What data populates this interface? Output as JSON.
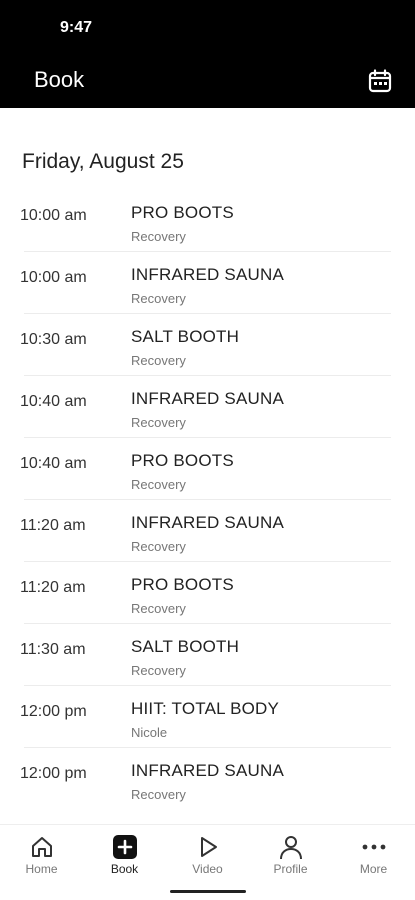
{
  "status_bar": {
    "time": "9:47"
  },
  "header": {
    "title": "Book",
    "calendar_icon": "calendar-icon"
  },
  "date_heading": "Friday, August 25",
  "classes": [
    {
      "time": "10:00 am",
      "name": "PRO BOOTS",
      "sub": "Recovery"
    },
    {
      "time": "10:00 am",
      "name": "INFRARED SAUNA",
      "sub": "Recovery"
    },
    {
      "time": "10:30 am",
      "name": "SALT BOOTH",
      "sub": "Recovery"
    },
    {
      "time": "10:40 am",
      "name": "INFRARED SAUNA",
      "sub": "Recovery"
    },
    {
      "time": "10:40 am",
      "name": "PRO BOOTS",
      "sub": "Recovery"
    },
    {
      "time": "11:20 am",
      "name": "INFRARED SAUNA",
      "sub": "Recovery"
    },
    {
      "time": "11:20 am",
      "name": "PRO BOOTS",
      "sub": "Recovery"
    },
    {
      "time": "11:30 am",
      "name": "SALT BOOTH",
      "sub": "Recovery"
    },
    {
      "time": "12:00 pm",
      "name": "HIIT: TOTAL BODY",
      "sub": "Nicole"
    },
    {
      "time": "12:00 pm",
      "name": "INFRARED SAUNA",
      "sub": "Recovery"
    }
  ],
  "bottom_nav": {
    "items": [
      {
        "label": "Home",
        "icon": "home-icon"
      },
      {
        "label": "Book",
        "icon": "plus-icon",
        "active": true
      },
      {
        "label": "Video",
        "icon": "play-icon"
      },
      {
        "label": "Profile",
        "icon": "person-icon"
      },
      {
        "label": "More",
        "icon": "more-icon"
      }
    ]
  },
  "colors": {
    "header_bg": "#000000",
    "text": "#222222",
    "muted": "#777777"
  }
}
